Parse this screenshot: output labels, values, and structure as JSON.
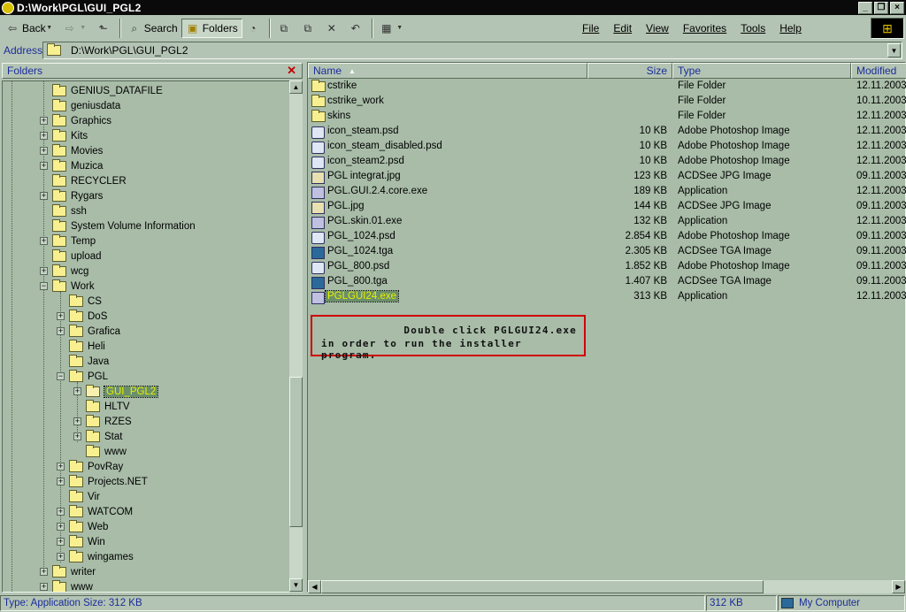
{
  "window": {
    "title": "D:\\Work\\PGL\\GUI_PGL2"
  },
  "toolbar": {
    "back_label": "Back",
    "search_label": "Search",
    "folders_label": "Folders"
  },
  "menu": {
    "file": "File",
    "edit": "Edit",
    "view": "View",
    "favorites": "Favorites",
    "tools": "Tools",
    "help": "Help"
  },
  "address": {
    "label": "Address",
    "value": "D:\\Work\\PGL\\GUI_PGL2"
  },
  "folders_pane": {
    "title": "Folders",
    "close_icon": "close-icon"
  },
  "tree": [
    {
      "label": "GENIUS_DATAFILE",
      "level": 1,
      "expander": "none"
    },
    {
      "label": "geniusdata",
      "level": 1,
      "expander": "none"
    },
    {
      "label": "Graphics",
      "level": 1,
      "expander": "plus"
    },
    {
      "label": "Kits",
      "level": 1,
      "expander": "plus"
    },
    {
      "label": "Movies",
      "level": 1,
      "expander": "plus"
    },
    {
      "label": "Muzica",
      "level": 1,
      "expander": "plus"
    },
    {
      "label": "RECYCLER",
      "level": 1,
      "expander": "none"
    },
    {
      "label": "Rygars",
      "level": 1,
      "expander": "plus"
    },
    {
      "label": "ssh",
      "level": 1,
      "expander": "none"
    },
    {
      "label": "System Volume Information",
      "level": 1,
      "expander": "none"
    },
    {
      "label": "Temp",
      "level": 1,
      "expander": "plus"
    },
    {
      "label": "upload",
      "level": 1,
      "expander": "none"
    },
    {
      "label": "wcg",
      "level": 1,
      "expander": "plus"
    },
    {
      "label": "Work",
      "level": 1,
      "expander": "minus"
    },
    {
      "label": "CS",
      "level": 2,
      "expander": "none"
    },
    {
      "label": "DoS",
      "level": 2,
      "expander": "plus"
    },
    {
      "label": "Grafica",
      "level": 2,
      "expander": "plus"
    },
    {
      "label": "Heli",
      "level": 2,
      "expander": "none"
    },
    {
      "label": "Java",
      "level": 2,
      "expander": "none"
    },
    {
      "label": "PGL",
      "level": 2,
      "expander": "minus"
    },
    {
      "label": "GUI_PGL2",
      "level": 3,
      "expander": "plus",
      "selected": true
    },
    {
      "label": "HLTV",
      "level": 3,
      "expander": "none"
    },
    {
      "label": "RZES",
      "level": 3,
      "expander": "plus"
    },
    {
      "label": "Stat",
      "level": 3,
      "expander": "plus"
    },
    {
      "label": "www",
      "level": 3,
      "expander": "none"
    },
    {
      "label": "PovRay",
      "level": 2,
      "expander": "plus"
    },
    {
      "label": "Projects.NET",
      "level": 2,
      "expander": "plus"
    },
    {
      "label": "Vir",
      "level": 2,
      "expander": "none"
    },
    {
      "label": "WATCOM",
      "level": 2,
      "expander": "plus"
    },
    {
      "label": "Web",
      "level": 2,
      "expander": "plus"
    },
    {
      "label": "Win",
      "level": 2,
      "expander": "plus"
    },
    {
      "label": "wingames",
      "level": 2,
      "expander": "plus"
    },
    {
      "label": "writer",
      "level": 1,
      "expander": "plus"
    },
    {
      "label": "www",
      "level": 1,
      "expander": "plus"
    }
  ],
  "columns": {
    "name": "Name",
    "size": "Size",
    "type": "Type",
    "modified": "Modified"
  },
  "files": [
    {
      "name": "cstrike",
      "size": "",
      "type": "File Folder",
      "modified": "12.11.2003",
      "icon": "folder"
    },
    {
      "name": "cstrike_work",
      "size": "",
      "type": "File Folder",
      "modified": "10.11.2003",
      "icon": "folder"
    },
    {
      "name": "skins",
      "size": "",
      "type": "File Folder",
      "modified": "12.11.2003",
      "icon": "folder"
    },
    {
      "name": "icon_steam.psd",
      "size": "10 KB",
      "type": "Adobe Photoshop Image",
      "modified": "12.11.2003",
      "icon": "psd"
    },
    {
      "name": "icon_steam_disabled.psd",
      "size": "10 KB",
      "type": "Adobe Photoshop Image",
      "modified": "12.11.2003",
      "icon": "psd"
    },
    {
      "name": "icon_steam2.psd",
      "size": "10 KB",
      "type": "Adobe Photoshop Image",
      "modified": "12.11.2003",
      "icon": "psd"
    },
    {
      "name": "PGL integrat.jpg",
      "size": "123 KB",
      "type": "ACDSee JPG Image",
      "modified": "09.11.2003",
      "icon": "jpg"
    },
    {
      "name": "PGL.GUI.2.4.core.exe",
      "size": "189 KB",
      "type": "Application",
      "modified": "12.11.2003",
      "icon": "exe"
    },
    {
      "name": "PGL.jpg",
      "size": "144 KB",
      "type": "ACDSee JPG Image",
      "modified": "09.11.2003",
      "icon": "jpg"
    },
    {
      "name": "PGL.skin.01.exe",
      "size": "132 KB",
      "type": "Application",
      "modified": "12.11.2003",
      "icon": "exe"
    },
    {
      "name": "PGL_1024.psd",
      "size": "2.854 KB",
      "type": "Adobe Photoshop Image",
      "modified": "09.11.2003",
      "icon": "psd"
    },
    {
      "name": "PGL_1024.tga",
      "size": "2.305 KB",
      "type": "ACDSee TGA Image",
      "modified": "09.11.2003",
      "icon": "tga"
    },
    {
      "name": "PGL_800.psd",
      "size": "1.852 KB",
      "type": "Adobe Photoshop Image",
      "modified": "09.11.2003",
      "icon": "psd"
    },
    {
      "name": "PGL_800.tga",
      "size": "1.407 KB",
      "type": "ACDSee TGA Image",
      "modified": "09.11.2003",
      "icon": "tga"
    },
    {
      "name": "PGLGUI24.exe",
      "size": "313 KB",
      "type": "Application",
      "modified": "12.11.2003",
      "icon": "exe",
      "selected": true
    }
  ],
  "note": {
    "line1": "Double click PGLGUI24.exe",
    "line2": "in order to run the installer program.",
    "border_color": "#d00000"
  },
  "status": {
    "type_text": "Type: Application Size: 312 KB",
    "size_text": "312 KB",
    "zone_text": "My Computer"
  }
}
